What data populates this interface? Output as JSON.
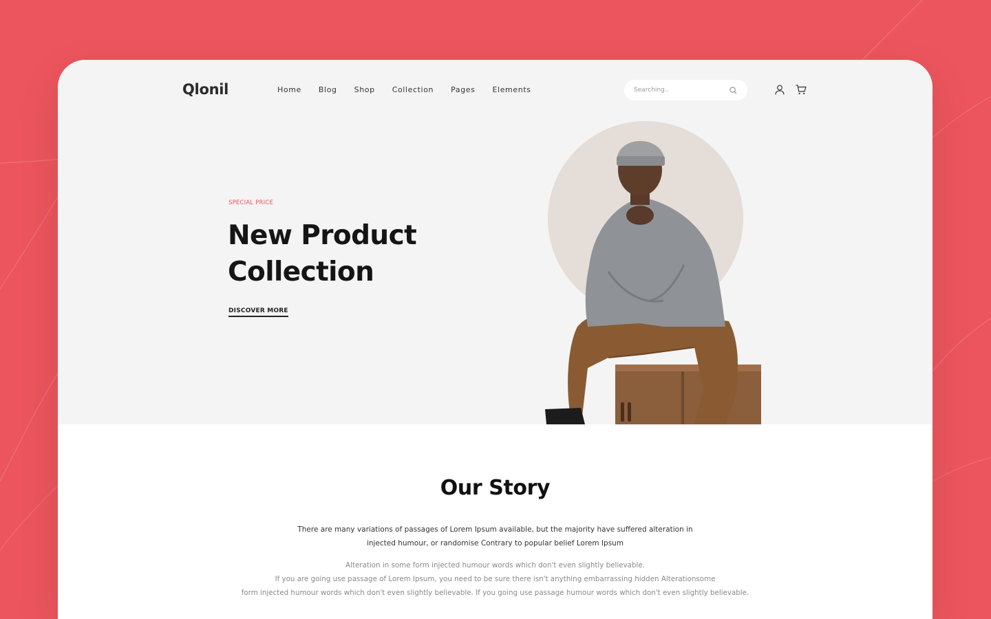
{
  "brand": {
    "logo_text": "Qlonil"
  },
  "nav": {
    "items": [
      {
        "label": "Home"
      },
      {
        "label": "Blog"
      },
      {
        "label": "Shop"
      },
      {
        "label": "Collection"
      },
      {
        "label": "Pages"
      },
      {
        "label": "Elements"
      }
    ]
  },
  "search": {
    "placeholder": "Searching..",
    "icon": "search-icon"
  },
  "header_icons": {
    "account": "user-icon",
    "cart": "cart-icon"
  },
  "hero": {
    "eyebrow": "SPECIAL PRICE",
    "title": "New Product Collection",
    "cta_label": "DISCOVER MORE",
    "image": "man-sitting-on-wooden-box-photo"
  },
  "story": {
    "title": "Our Story",
    "lead": "There are many variations of passages of Lorem Ipsum available, but the majority have suffered alteration in injected humour, or randomise Contrary to popular belief Lorem Ipsum",
    "body_lines": [
      "Alteration in some form injected humour words which don't even slightly believable.",
      "If you are going use passage of Lorem Ipsum, you need to be sure there isn't anything embarrassing hidden Alterationsome",
      "form injected humour words which don't even slightly believable. If you going use passage humour words which don't even slightly believable."
    ]
  },
  "colors": {
    "page_background": "#ec555d",
    "accent": "#e8525b",
    "hero_background": "#f4f4f4",
    "hero_circle": "#e4ddd8"
  }
}
